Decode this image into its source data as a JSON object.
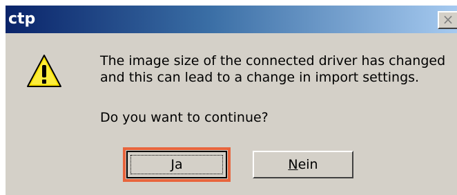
{
  "window": {
    "title": "ctp",
    "close_glyph": "×"
  },
  "message": {
    "icon": "warning-icon",
    "line1": "The image size of the connected driver has changed",
    "line2": "and this can lead to a change in import settings.",
    "question": "Do you want to continue?"
  },
  "buttons": {
    "yes_mnemonic": "J",
    "yes_rest": "a",
    "no_mnemonic": "N",
    "no_rest": "ein",
    "focused": "yes"
  },
  "colors": {
    "titlebar_start": "#0a246a",
    "titlebar_end": "#a6caf0",
    "dialog_face": "#d4d0c8",
    "highlight_outline": "#e8643c",
    "warning_yellow": "#f8e000"
  }
}
